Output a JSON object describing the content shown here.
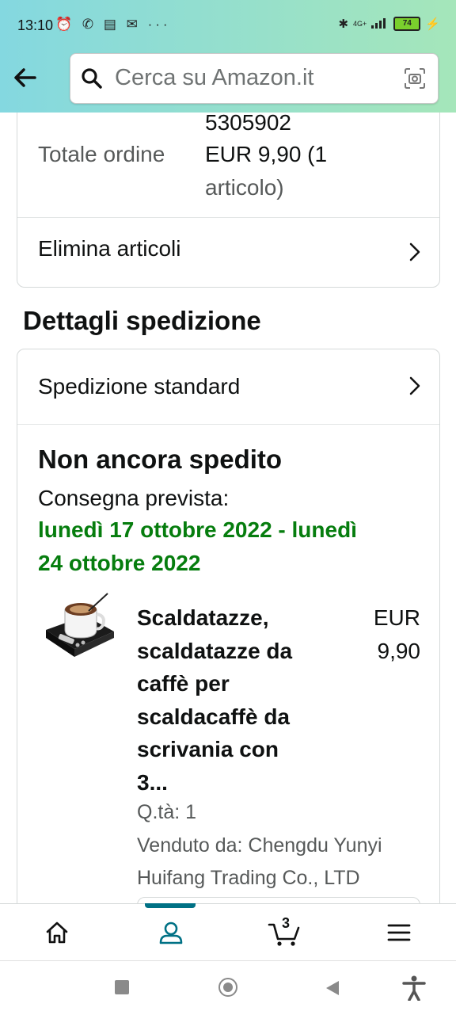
{
  "status": {
    "time": "13:10",
    "battery": "74",
    "network": "4G+"
  },
  "search": {
    "placeholder": "Cerca su Amazon.it"
  },
  "order": {
    "number_tail": "5305902",
    "total_label": "Totale ordine",
    "total_value_line1": "EUR 9,90 (1",
    "total_value_line2": "articolo)",
    "delete_items": "Elimina articoli"
  },
  "shipping": {
    "section_title": "Dettagli spedizione",
    "method": "Spedizione standard",
    "status_title": "Non ancora spedito",
    "delivery_label": "Consegna prevista:",
    "delivery_line1": "lunedì 17 ottobre 2022 - lunedì",
    "delivery_line2": "24 ottobre 2022",
    "item": {
      "title_lines": [
        "Scaldatazze,",
        "scaldatazze da",
        "caffè per",
        "scaldacaffè da",
        "scrivania con",
        "3..."
      ],
      "price_line1": "EUR",
      "price_line2": "9,90",
      "qty": "Q.tà: 1",
      "seller_line1": "Venduto da: Chengdu Yunyi",
      "seller_line2": "Huifang Trading Co., LTD"
    }
  },
  "nav": {
    "cart_count": "3"
  },
  "colors": {
    "accent": "#007185",
    "green": "#067d0e"
  }
}
